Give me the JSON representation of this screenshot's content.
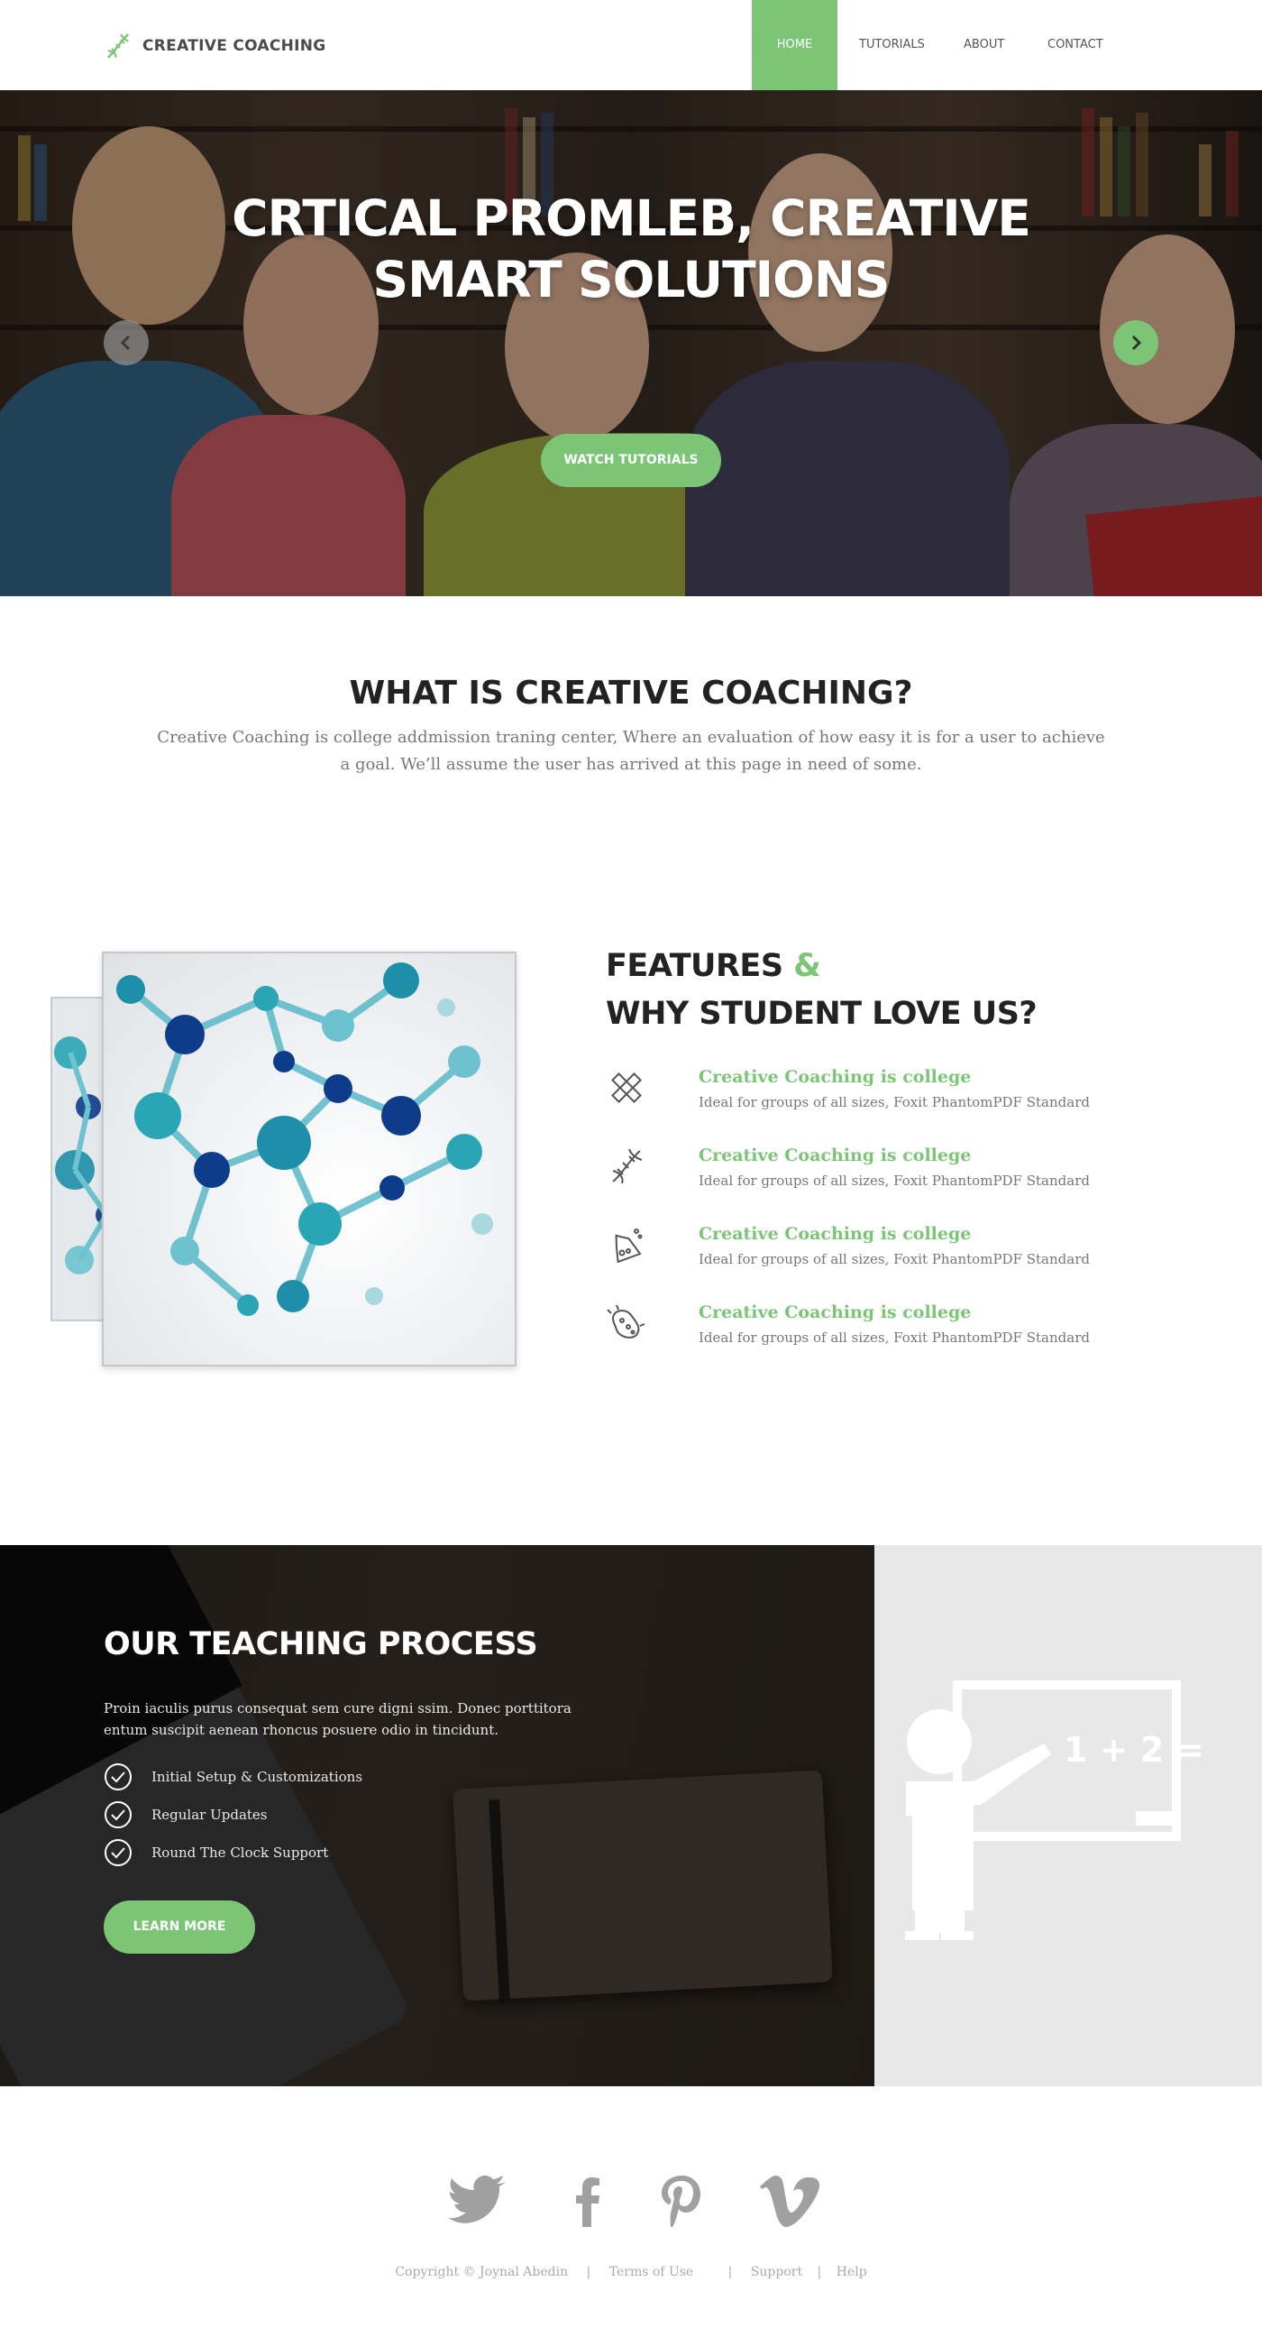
{
  "header": {
    "brand": "CREATIVE COACHING",
    "nav": {
      "home": "HOME",
      "tutorials": "TUTORIALS",
      "about": "ABOUT",
      "contact": "CONTACT"
    }
  },
  "hero": {
    "title_line1": "CRTICAL PROMLEB, CREATIVE",
    "title_line2": "SMART SOLUTIONS",
    "button": "WATCH TUTORIALS"
  },
  "about": {
    "title": "WHAT IS CREATIVE COACHING?",
    "description": "Creative Coaching is college addmission traning center, Where  an evaluation of how easy it is for a user to achieve a goal. We’ll assume the user has arrived at this page in need of some."
  },
  "features": {
    "title_part1": "FEATURES ",
    "title_amp": "&",
    "title_line2": "WHY STUDENT LOVE US?",
    "items": [
      {
        "icon": "pencil-ruler-icon",
        "title": "Creative Coaching is college",
        "subtitle": "Ideal for groups of all sizes, Foxit PhantomPDF Standard"
      },
      {
        "icon": "dna-icon",
        "title": "Creative Coaching is college",
        "subtitle": "Ideal for groups of all sizes, Foxit PhantomPDF Standard"
      },
      {
        "icon": "flask-icon",
        "title": "Creative Coaching is college",
        "subtitle": "Ideal for groups of all sizes, Foxit PhantomPDF Standard"
      },
      {
        "icon": "bacteria-icon",
        "title": "Creative Coaching is college",
        "subtitle": "Ideal for groups of all sizes, Foxit PhantomPDF Standard"
      }
    ]
  },
  "process": {
    "title": "OUR TEACHING PROCESS",
    "description": "Proin iaculis purus consequat sem cure  digni ssim. Donec porttitora entum suscipit  aenean rhoncus posuere odio in tincidunt.",
    "list": [
      "Initial Setup & Customizations",
      "Regular Updates",
      "Round The Clock Support"
    ],
    "button": "LEARN MORE",
    "board_text": "1 + 2 ="
  },
  "footer": {
    "social": [
      "twitter-icon",
      "facebook-icon",
      "pinterest-icon",
      "vimeo-icon"
    ],
    "copyright": "Copyright ©  Joynal Abedin",
    "terms": "Terms of Use",
    "support": "Support",
    "help": "Help",
    "separator": "|"
  },
  "colors": {
    "accent": "#7cc576",
    "dark_text": "#222222",
    "muted_text": "#777777",
    "footer_icon": "#a0a0a0"
  }
}
